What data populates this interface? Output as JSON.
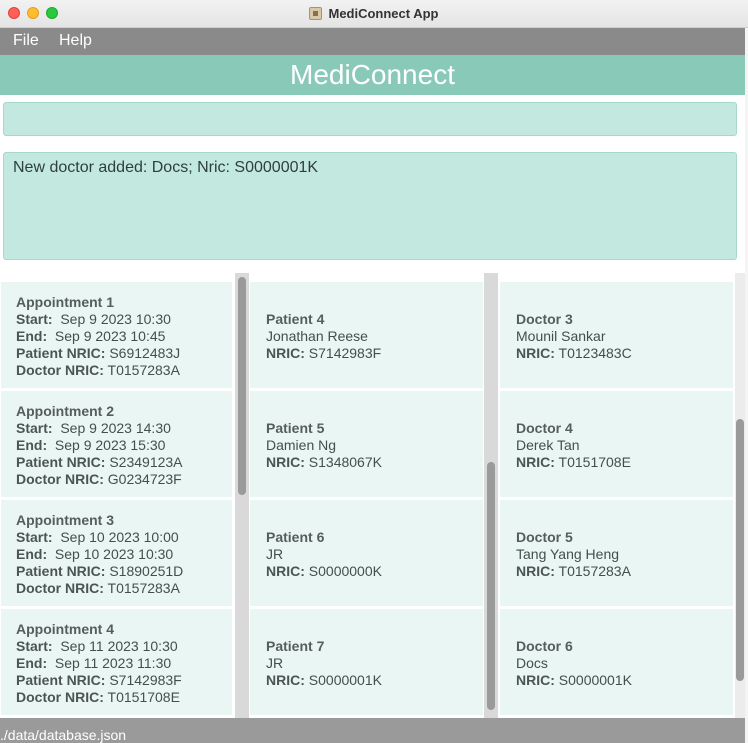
{
  "window": {
    "title": "MediConnect App"
  },
  "menu": {
    "file": "File",
    "help": "Help"
  },
  "header": {
    "title": "MediConnect"
  },
  "command": {
    "value": ""
  },
  "result": {
    "text": "New doctor added: Docs; Nric: S0000001K"
  },
  "labels": {
    "start": "Start:",
    "end": "End:",
    "patient_nric": "Patient NRIC:",
    "doctor_nric": "Doctor NRIC:",
    "nric": "NRIC:"
  },
  "appointments": [
    {
      "title": "Appointment 1",
      "start": "Sep 9 2023 10:30",
      "end": "Sep 9 2023 10:45",
      "patient_nric": "S6912483J",
      "doctor_nric": "T0157283A"
    },
    {
      "title": "Appointment 2",
      "start": "Sep 9 2023 14:30",
      "end": "Sep 9 2023 15:30",
      "patient_nric": "S2349123A",
      "doctor_nric": "G0234723F"
    },
    {
      "title": "Appointment 3",
      "start": "Sep 10 2023 10:00",
      "end": "Sep 10 2023 10:30",
      "patient_nric": "S1890251D",
      "doctor_nric": "T0157283A"
    },
    {
      "title": "Appointment 4",
      "start": "Sep 11 2023 10:30",
      "end": "Sep 11 2023 11:30",
      "patient_nric": "S7142983F",
      "doctor_nric": "T0151708E"
    }
  ],
  "patients": [
    {
      "title": "Patient 4",
      "name": "Jonathan Reese",
      "nric": "S7142983F"
    },
    {
      "title": "Patient 5",
      "name": "Damien Ng",
      "nric": "S1348067K"
    },
    {
      "title": "Patient 6",
      "name": "JR",
      "nric": "S0000000K"
    },
    {
      "title": "Patient 7",
      "name": "JR",
      "nric": "S0000001K"
    }
  ],
  "doctors": [
    {
      "title": "Doctor 3",
      "name": "Mounil Sankar",
      "nric": "T0123483C"
    },
    {
      "title": "Doctor 4",
      "name": "Derek Tan",
      "nric": "T0151708E"
    },
    {
      "title": "Doctor 5",
      "name": "Tang Yang Heng",
      "nric": "T0157283A"
    },
    {
      "title": "Doctor 6",
      "name": "Docs",
      "nric": "S0000001K"
    }
  ],
  "status": {
    "path": "./data/database.json"
  },
  "colors": {
    "accent": "#89c9b8",
    "card": "#eaf6f3",
    "panel": "#c2e8e0"
  },
  "icons": {
    "app": "app-icon"
  }
}
